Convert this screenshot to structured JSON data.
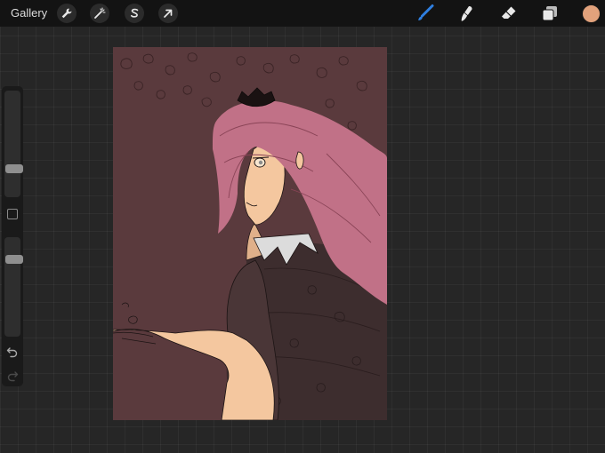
{
  "toolbar": {
    "gallery_label": "Gallery",
    "left_icons": [
      "wrench-icon",
      "magic-wand-icon",
      "selection-s-icon",
      "transform-arrow-icon"
    ],
    "right_icons": [
      "brush-icon",
      "smudge-icon",
      "eraser-icon",
      "layers-icon"
    ],
    "active_tool": "brush",
    "active_tool_color": "#2f7fe0",
    "current_color": "#e2a27c"
  },
  "sidebar": {
    "brush_size_level": 0.55,
    "opacity_level": 0.2,
    "modifier_icon": "square-modifier-icon",
    "undo_icon": "undo-icon",
    "redo_icon": "redo-icon"
  },
  "canvas": {
    "background_color": "#5a3a3d",
    "hair_color": "#c17187",
    "skin_color": "#f4c79f",
    "cloak_color": "#3d2d2e"
  }
}
